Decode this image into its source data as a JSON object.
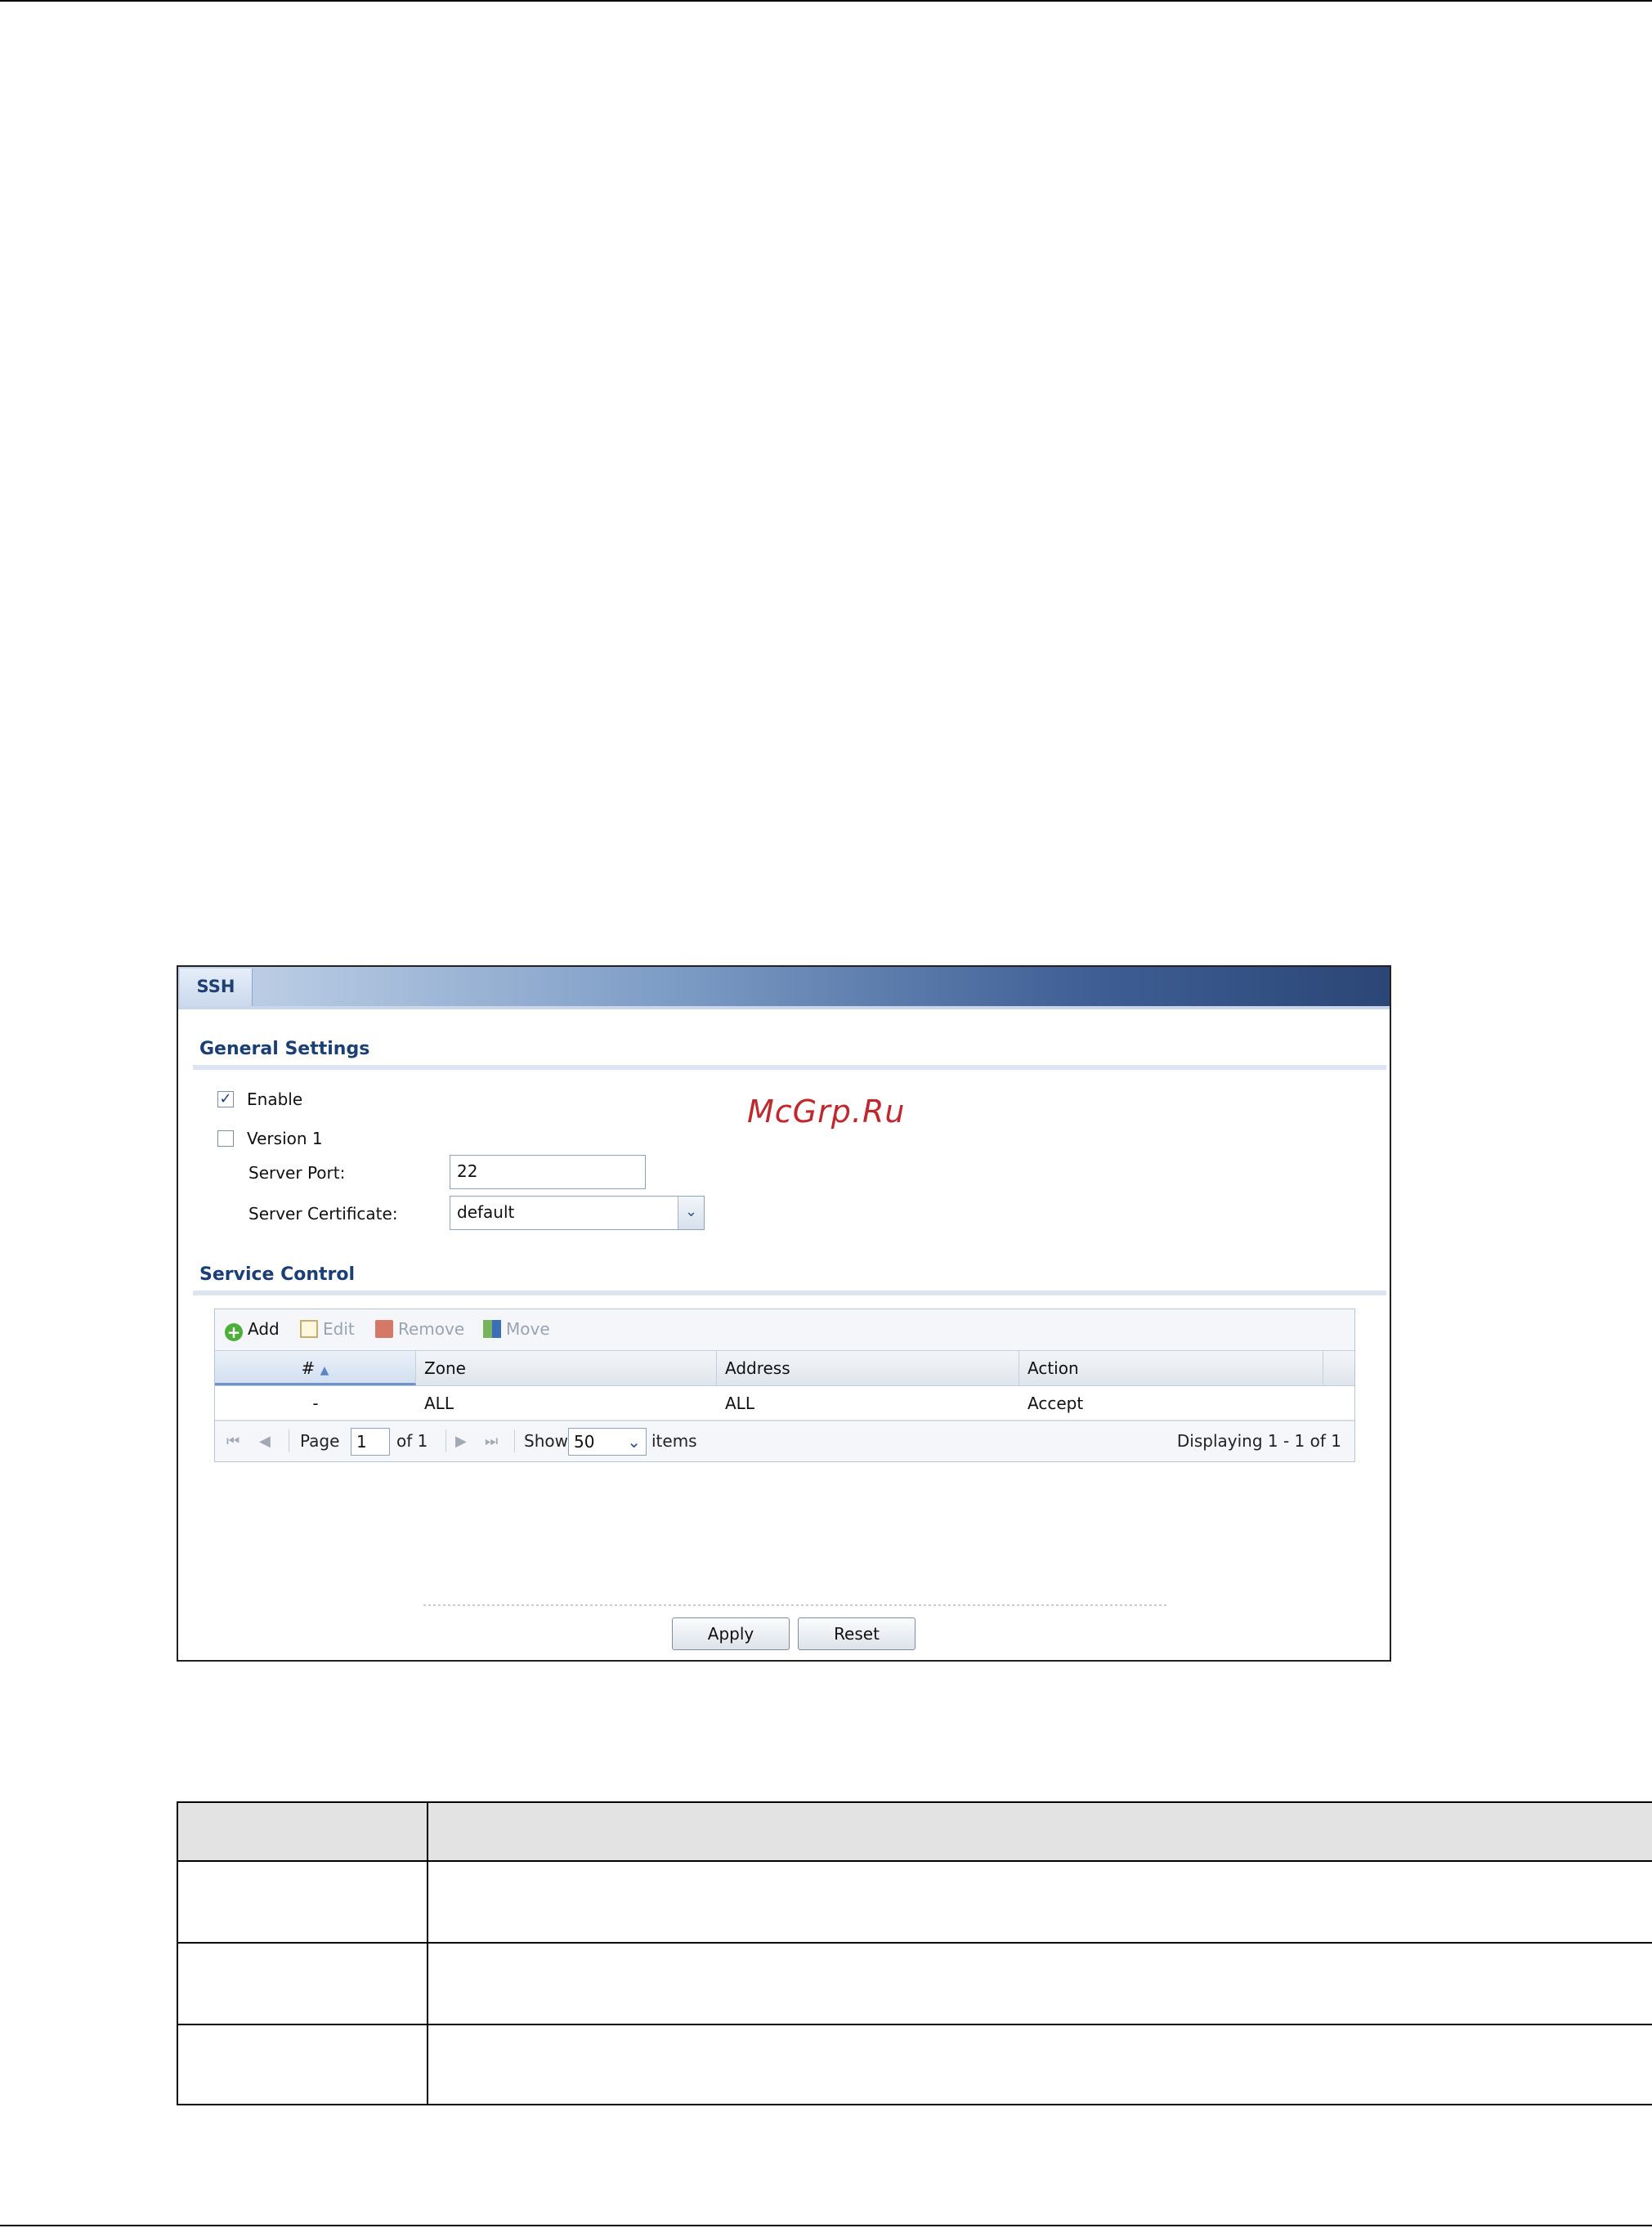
{
  "watermark": "McGrp.Ru",
  "tab": {
    "label": "SSH"
  },
  "general_settings": {
    "title": "General Settings",
    "enable_label": "Enable",
    "enable_checked": true,
    "version1_label": "Version 1",
    "version1_checked": false,
    "server_port_label": "Server Port:",
    "server_port_value": "22",
    "server_certificate_label": "Server Certificate:",
    "server_certificate_value": "default"
  },
  "service_control": {
    "title": "Service Control",
    "toolbar": {
      "add": "Add",
      "edit": "Edit",
      "remove": "Remove",
      "move": "Move"
    },
    "columns": [
      "#",
      "Zone",
      "Address",
      "Action"
    ],
    "rows": [
      {
        "num": "-",
        "zone": "ALL",
        "address": "ALL",
        "action": "Accept"
      }
    ],
    "pager": {
      "page_label": "Page",
      "page_value": "1",
      "of_label": "of 1",
      "show_label": "Show",
      "show_value": "50",
      "items_label": "items",
      "displaying": "Displaying 1 - 1 of 1"
    }
  },
  "buttons": {
    "apply": "Apply",
    "reset": "Reset"
  }
}
